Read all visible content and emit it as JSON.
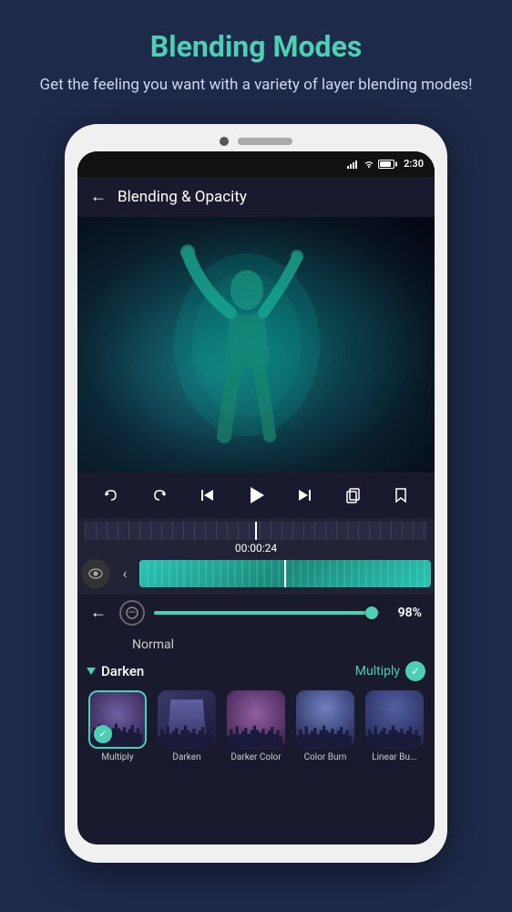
{
  "header": {
    "title": "Blending Modes",
    "subtitle": "Get the feeling you want with a variety of layer blending modes!"
  },
  "phone": {
    "status_bar": {
      "time": "2:30"
    },
    "app_header": {
      "back_label": "←",
      "title": "Blending & Opacity"
    },
    "timeline": {
      "timestamp": "00:00:24"
    },
    "controls": {
      "opacity_value": "98%",
      "blend_mode_current": "Normal"
    },
    "blend_section": {
      "group_name": "Darken",
      "active_mode": "Multiply",
      "items": [
        {
          "label": "Multiply",
          "selected": true
        },
        {
          "label": "Darken",
          "selected": false
        },
        {
          "label": "Darker Color",
          "selected": false
        },
        {
          "label": "Color Burn",
          "selected": false
        },
        {
          "label": "Linear Bu...",
          "selected": false
        }
      ]
    }
  },
  "icons": {
    "back": "←",
    "play": "▶",
    "undo": "↩",
    "redo": "↪",
    "skip_back": "|◀",
    "skip_fwd": "▶|",
    "copy": "⧉",
    "bookmark": "🔖",
    "eye": "👁",
    "chevron_left": "‹",
    "check": "✓"
  }
}
